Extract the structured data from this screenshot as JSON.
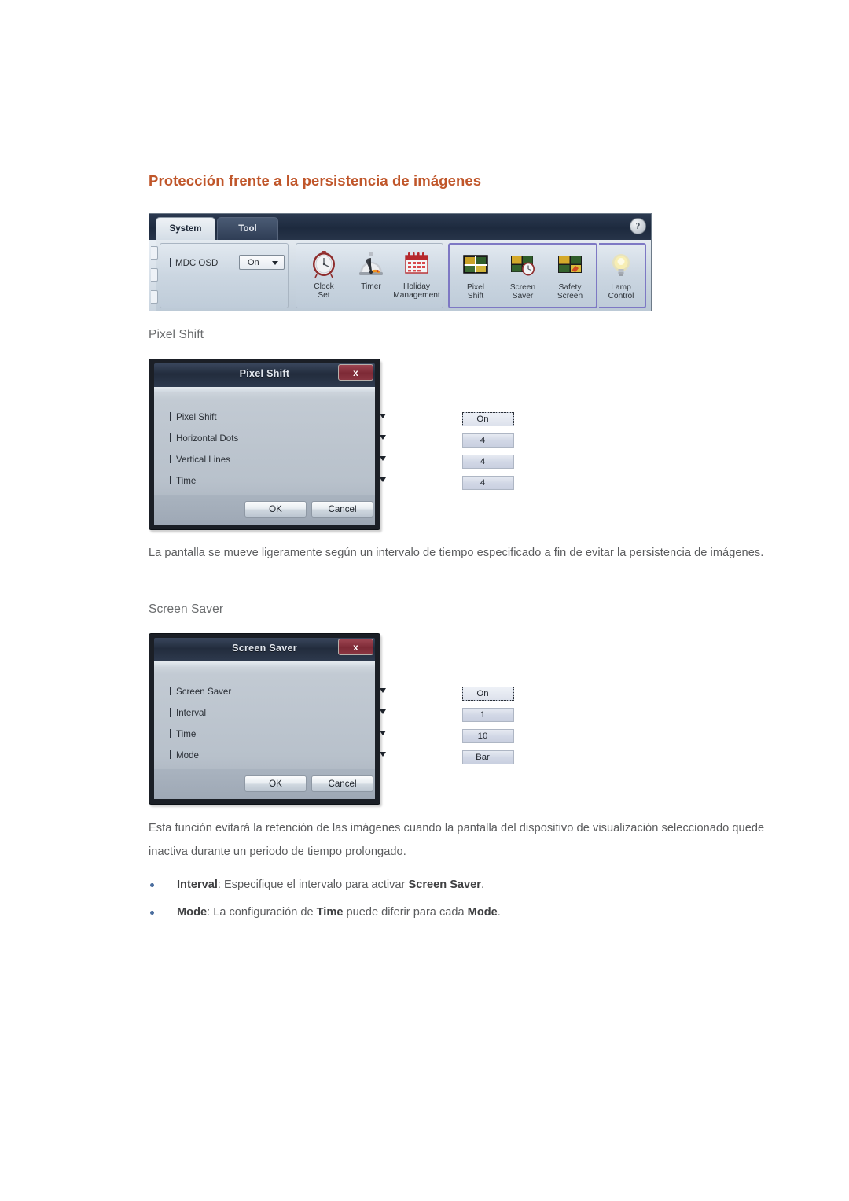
{
  "page": {
    "title": "Protección frente a la persistencia de imágenes"
  },
  "toolbar": {
    "tabs": [
      {
        "label": "System",
        "active": true
      },
      {
        "label": "Tool",
        "active": false
      }
    ],
    "help_icon": "?",
    "osd": {
      "label": "MDC OSD",
      "value": "On"
    },
    "tools": [
      {
        "label_line1": "Clock",
        "label_line2": "Set",
        "icon": "clock-icon"
      },
      {
        "label_line1": "Timer",
        "label_line2": "",
        "icon": "timer-icon"
      },
      {
        "label_line1": "Holiday",
        "label_line2": "Management",
        "icon": "calendar-icon"
      },
      {
        "label_line1": "Pixel",
        "label_line2": "Shift",
        "icon": "pixel-shift-icon"
      },
      {
        "label_line1": "Screen",
        "label_line2": "Saver",
        "icon": "screen-saver-icon"
      },
      {
        "label_line1": "Safety",
        "label_line2": "Screen",
        "icon": "safety-screen-icon"
      },
      {
        "label_line1": "Lamp",
        "label_line2": "Control",
        "icon": "lamp-icon"
      }
    ],
    "selection_highlight_color": "#7d78c4"
  },
  "sections": [
    {
      "heading": "Pixel Shift",
      "paragraph": "La pantalla se mueve ligeramente según un intervalo de tiempo especificado a fin de evitar la persistencia de imágenes."
    },
    {
      "heading": "Screen Saver",
      "paragraph": "Esta función evitará la retención de las imágenes cuando la pantalla del dispositivo de visualización seleccionado quede inactiva durante un periodo de tiempo prolongado."
    }
  ],
  "dialogs": {
    "pixel_shift": {
      "title": "Pixel Shift",
      "close_label": "x",
      "fields": [
        {
          "label": "Pixel Shift",
          "value": "On",
          "focused": true
        },
        {
          "label": "Horizontal Dots",
          "value": "4",
          "focused": false
        },
        {
          "label": "Vertical Lines",
          "value": "4",
          "focused": false
        },
        {
          "label": "Time",
          "value": "4",
          "focused": false
        }
      ],
      "ok_label": "OK",
      "cancel_label": "Cancel"
    },
    "screen_saver": {
      "title": "Screen Saver",
      "close_label": "x",
      "fields": [
        {
          "label": "Screen Saver",
          "value": "On",
          "focused": true
        },
        {
          "label": "Interval",
          "value": "1",
          "focused": false
        },
        {
          "label": "Time",
          "value": "10",
          "focused": false
        },
        {
          "label": "Mode",
          "value": "Bar",
          "focused": false
        }
      ],
      "ok_label": "OK",
      "cancel_label": "Cancel"
    }
  },
  "bullets": [
    {
      "parts": [
        {
          "text": "Interval",
          "bold": true
        },
        {
          "text": ": Especifique el intervalo para activar ",
          "bold": false
        },
        {
          "text": "Screen Saver",
          "bold": true
        },
        {
          "text": ".",
          "bold": false
        }
      ]
    },
    {
      "parts": [
        {
          "text": "Mode",
          "bold": true
        },
        {
          "text": ": La configuración de ",
          "bold": false
        },
        {
          "text": "Time",
          "bold": true
        },
        {
          "text": " puede diferir para cada ",
          "bold": false
        },
        {
          "text": "Mode",
          "bold": true
        },
        {
          "text": ".",
          "bold": false
        }
      ]
    }
  ],
  "colors": {
    "title": "#c0562a",
    "heading": "#6a6c6e",
    "body_text": "#5b5c5e",
    "bullet_dot": "#4a6d9e",
    "dialog_close": "#8b3642",
    "tab_bar": "#1d2a3e"
  }
}
